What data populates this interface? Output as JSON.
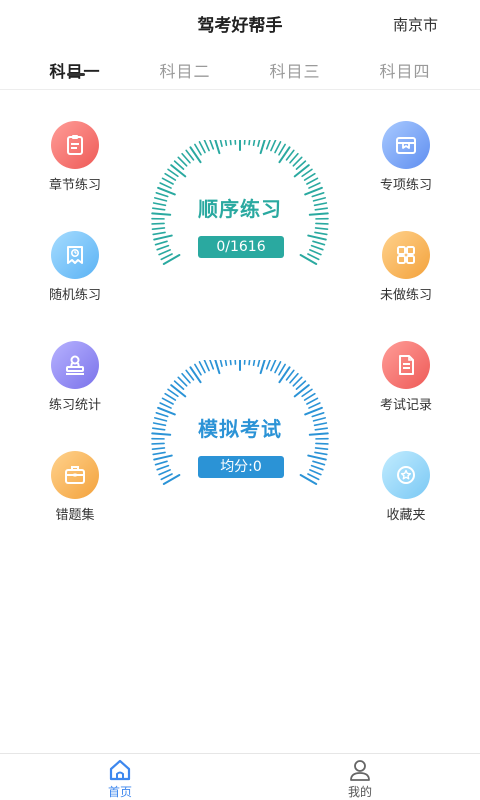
{
  "header": {
    "title": "驾考好帮手",
    "city": "南京市"
  },
  "tabs": [
    {
      "label": "科目一",
      "active": true
    },
    {
      "label": "科目二",
      "active": false
    },
    {
      "label": "科目三",
      "active": false
    },
    {
      "label": "科目四",
      "active": false
    }
  ],
  "features": {
    "left": [
      {
        "label": "章节练习",
        "icon": "clipboard-icon",
        "color": "#ee5a57"
      },
      {
        "label": "随机练习",
        "icon": "calendar-icon",
        "color": "#5ab2f4"
      },
      {
        "label": "练习统计",
        "icon": "stamp-icon",
        "color": "#7a72ea"
      },
      {
        "label": "错题集",
        "icon": "briefcase-icon",
        "color": "#f3a23c"
      }
    ],
    "right": [
      {
        "label": "专项练习",
        "icon": "box-icon",
        "color": "#5f8ef0"
      },
      {
        "label": "未做练习",
        "icon": "grid-icon",
        "color": "#f3a23c"
      },
      {
        "label": "考试记录",
        "icon": "document-icon",
        "color": "#ee5a57"
      },
      {
        "label": "收藏夹",
        "icon": "star-icon",
        "color": "#7ac8f4"
      }
    ]
  },
  "sequential_practice": {
    "title": "顺序练习",
    "progress_text": "0/1616",
    "color": "#2aa9a0"
  },
  "mock_exam": {
    "title": "模拟考试",
    "score_text": "均分:0",
    "color": "#2b93d6"
  },
  "bottom_nav": [
    {
      "label": "首页",
      "icon": "home-icon",
      "active": true,
      "color": "#3d87ee"
    },
    {
      "label": "我的",
      "icon": "user-icon",
      "active": false,
      "color": "#555555"
    }
  ]
}
